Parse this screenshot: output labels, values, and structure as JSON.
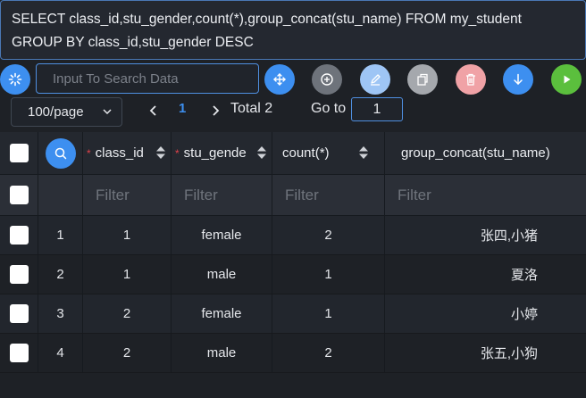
{
  "sql": {
    "text": "SELECT class_id,stu_gender,count(*),group_concat(stu_name) FROM my_student\nGROUP BY class_id,stu_gender DESC"
  },
  "toolbar": {
    "search_placeholder": "Input To Search Data",
    "buttons": [
      {
        "name": "refresh-button",
        "icon": "loader-icon",
        "color": "#3d8ff0"
      },
      {
        "name": "move-button",
        "icon": "move-arrows-icon",
        "color": "#3d8ff0"
      },
      {
        "name": "add-row-button",
        "icon": "plus-circle-icon",
        "color": "#6e737b"
      },
      {
        "name": "edit-button",
        "icon": "pencil-icon",
        "color": "#9ec5f5"
      },
      {
        "name": "copy-button",
        "icon": "copy-icon",
        "color": "#a5a8ad"
      },
      {
        "name": "delete-button",
        "icon": "trash-icon",
        "color": "#f0a2a6"
      },
      {
        "name": "download-button",
        "icon": "arrow-down-icon",
        "color": "#3d8ff0"
      },
      {
        "name": "execute-button",
        "icon": "play-icon",
        "color": "#5bbf3d"
      }
    ]
  },
  "pager": {
    "page_size": "100/page",
    "current_page": "1",
    "total": "Total 2",
    "goto_label": "Go to",
    "goto_value": "1"
  },
  "grid": {
    "columns": [
      {
        "label": "class_id",
        "required": "*"
      },
      {
        "label": "stu_gende",
        "required": "*"
      },
      {
        "label": "count(*)",
        "required": ""
      },
      {
        "label": "group_concat(stu_name)",
        "required": ""
      }
    ],
    "filter_placeholder": "Filter",
    "rows": [
      {
        "index": "1",
        "class_id": "1",
        "stu_gender": "female",
        "count": "2",
        "names": "张四,小猪"
      },
      {
        "index": "2",
        "class_id": "1",
        "stu_gender": "male",
        "count": "1",
        "names": "夏洛"
      },
      {
        "index": "3",
        "class_id": "2",
        "stu_gender": "female",
        "count": "1",
        "names": "小婷"
      },
      {
        "index": "4",
        "class_id": "2",
        "stu_gender": "male",
        "count": "2",
        "names": "张五,小狗"
      }
    ]
  },
  "colors": {
    "accent": "#3d8ff0",
    "background": "#1e2126",
    "required_mark": "#e0424b"
  }
}
